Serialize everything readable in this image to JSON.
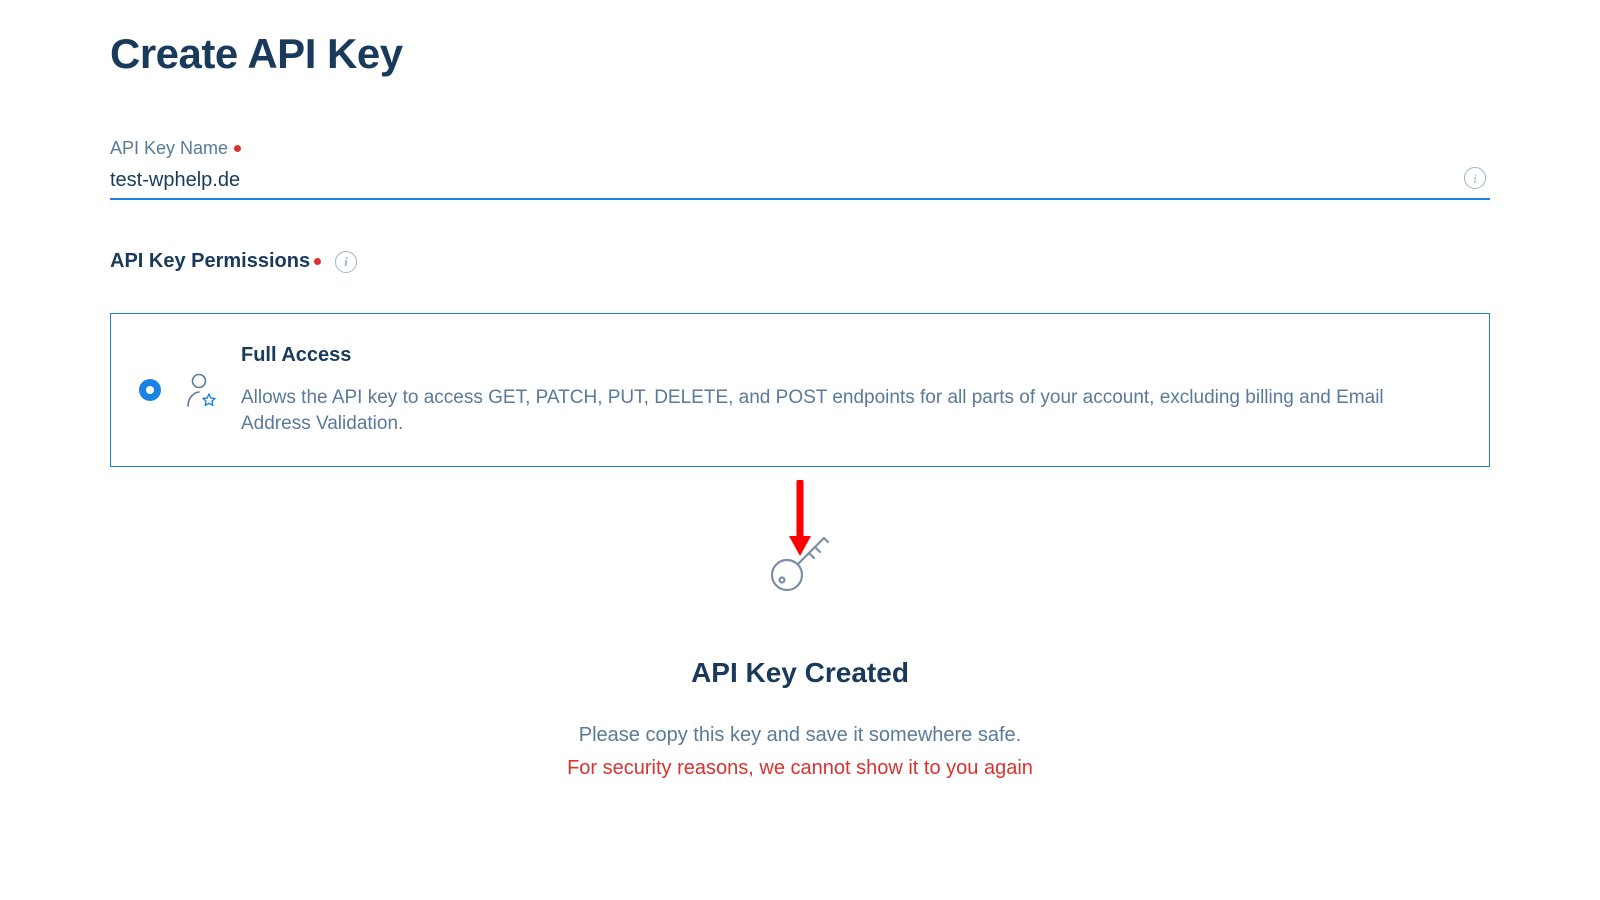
{
  "page": {
    "title": "Create API Key"
  },
  "nameField": {
    "label": "API Key Name",
    "value": "test-wphelp.de"
  },
  "permissions": {
    "label": "API Key Permissions",
    "option": {
      "title": "Full Access",
      "description": "Allows the API key to access GET, PATCH, PUT, DELETE, and POST endpoints for all parts of your account, excluding billing and Email Address Validation."
    }
  },
  "created": {
    "title": "API Key Created",
    "copyText": "Please copy this key and save it somewhere safe.",
    "warnText": "For security reasons, we cannot show it to you again"
  }
}
